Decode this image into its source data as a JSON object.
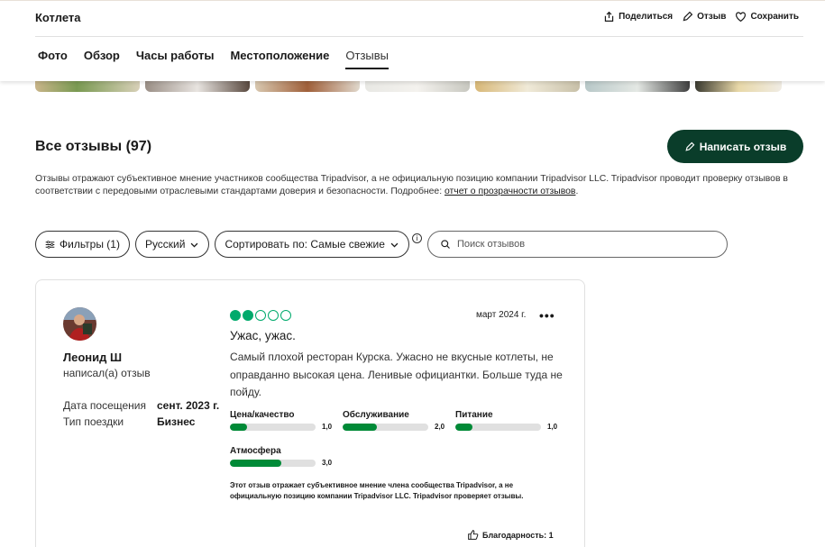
{
  "header": {
    "place_name": "Котлета",
    "actions": {
      "share": "Поделиться",
      "review": "Отзыв",
      "save": "Сохранить"
    },
    "tabs": [
      {
        "label": "Фото"
      },
      {
        "label": "Обзор"
      },
      {
        "label": "Часы работы"
      },
      {
        "label": "Местоположение"
      },
      {
        "label": "Отзывы",
        "active": true
      }
    ]
  },
  "reviews": {
    "title": "Все отзывы (97)",
    "write_button": "Написать отзыв",
    "disclaimer_text": "Отзывы отражают субъективное мнение участников сообщества Tripadvisor, а не официальную позицию компании Tripadvisor LLC. Tripadvisor проводит проверку отзывов в соответствии с передовыми отраслевыми стандартами доверия и безопасности. Подробнее: ",
    "disclaimer_link": "отчет о прозрачности отзывов",
    "disclaimer_end": ".",
    "filters": {
      "filter_label": "Фильтры (1)",
      "language": "Русский",
      "sort": "Сортировать по: Самые свежие",
      "info": "i"
    },
    "search_placeholder": "Поиск отзывов"
  },
  "review": {
    "user_name": "Леонид Ш",
    "user_sub": "написал(а) отзыв",
    "visit_date_label": "Дата посещения",
    "visit_date": "сент. 2023 г.",
    "trip_type_label": "Тип поездки",
    "trip_type": "Бизнес",
    "bubbles_rating": 2,
    "date": "март 2024 г.",
    "more": "•••",
    "title": "Ужас, ужас.",
    "text": "Самый плохой ресторан Курска. Ужасно не вкусные котлеты, не оправданно высокая цена. Ленивые официантки. Больше туда не пойду.",
    "ratings": [
      {
        "label": "Цена/качество",
        "value": "1,0",
        "score": 1.0
      },
      {
        "label": "Обслуживание",
        "value": "2,0",
        "score": 2.0
      },
      {
        "label": "Питание",
        "value": "1,0",
        "score": 1.0
      },
      {
        "label": "Атмосфера",
        "value": "3,0",
        "score": 3.0
      }
    ],
    "disclaimer": "Этот отзыв отражает субъективное мнение члена сообщества Tripadvisor, а не официальную позицию компании Tripadvisor LLC. Tripadvisor проверяет отзывы.",
    "thanks": "Благодарность: 1"
  },
  "colors": {
    "accent_dark": "#0a3d2a",
    "bubble_green": "#00aa6c",
    "bar_green": "#008a37"
  }
}
